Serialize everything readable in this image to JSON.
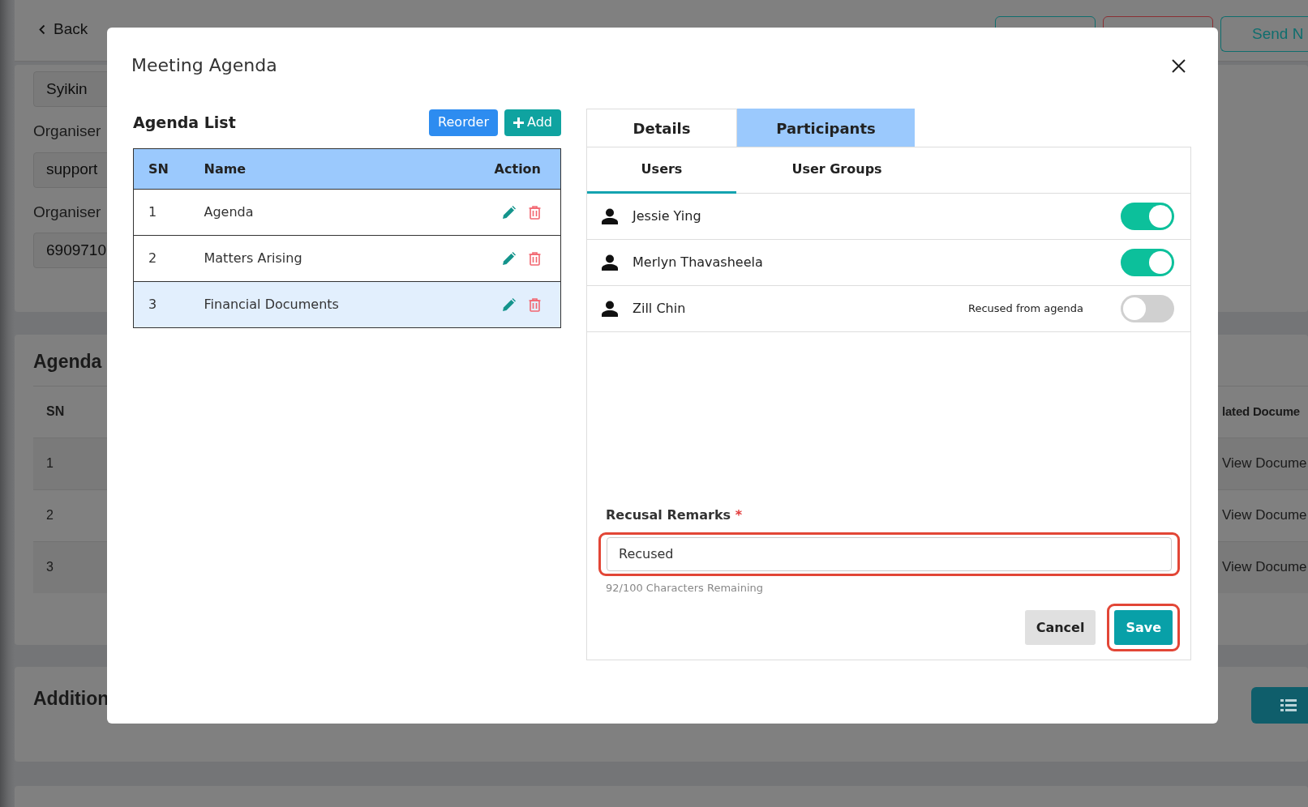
{
  "background_page": {
    "back_link": "Back",
    "header_buttons": [
      {
        "kind": "teal"
      },
      {
        "kind": "red"
      },
      {
        "label": "Send N",
        "kind": "teal"
      }
    ],
    "fields": [
      {
        "value": "Syikin"
      },
      {
        "label": "Organiser",
        "value": "support"
      },
      {
        "label": "Organiser",
        "value": "6909710"
      }
    ],
    "agenda_section": {
      "title": "Agenda",
      "column": "SN",
      "right_column": "lated Docume",
      "rows": [
        {
          "sn": "1",
          "link": "View Docume"
        },
        {
          "sn": "2",
          "link": "View Docume"
        },
        {
          "sn": "3",
          "link": "View Docume"
        }
      ]
    },
    "additional_section": {
      "title": "Addition"
    }
  },
  "modal": {
    "title": "Meeting Agenda",
    "agenda_list": {
      "title": "Agenda List",
      "buttons": [
        {
          "label": "Reorder",
          "kind": "reorder"
        },
        {
          "label": "Add",
          "kind": "add"
        }
      ],
      "columns": [
        "SN",
        "Name",
        "Action"
      ],
      "rows": [
        {
          "sn": "1",
          "name": "Agenda",
          "selected": false
        },
        {
          "sn": "2",
          "name": "Matters Arising",
          "selected": false
        },
        {
          "sn": "3",
          "name": "Financial Documents",
          "selected": true
        }
      ]
    },
    "participants_panel": {
      "tabs": [
        {
          "label": "Details",
          "selected": false
        },
        {
          "label": "Participants",
          "selected": true
        }
      ],
      "subtabs": [
        {
          "label": "Users",
          "selected": true
        },
        {
          "label": "User Groups",
          "selected": false
        }
      ],
      "users": [
        {
          "name": "Jessie Ying",
          "on": true
        },
        {
          "name": "Merlyn Thavasheela",
          "on": true
        },
        {
          "name": "Zill Chin",
          "on": false,
          "note": "Recused from agenda"
        }
      ],
      "remarks": {
        "label": "Recusal Remarks",
        "required_marker": "*",
        "value": "Recused",
        "highlighted": true,
        "helper": "92/100 Characters Remaining"
      },
      "actions": [
        {
          "label": "Cancel",
          "kind": "cancel",
          "highlighted": false
        },
        {
          "label": "Save",
          "kind": "save",
          "highlighted": true
        }
      ]
    }
  }
}
